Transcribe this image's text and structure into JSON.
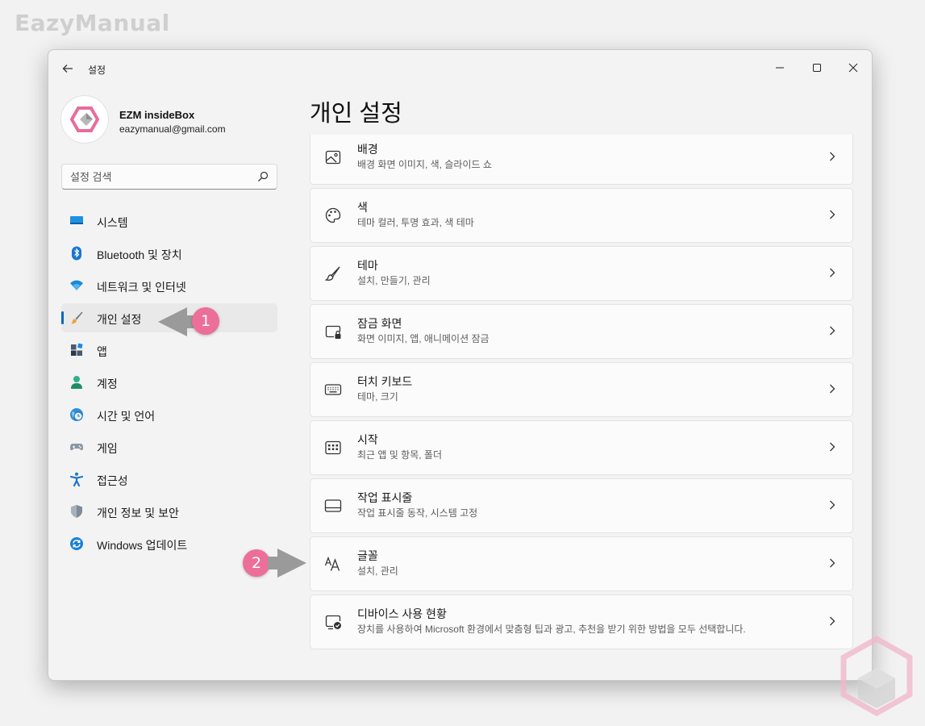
{
  "watermark": "EazyManual",
  "window": {
    "title": "설정",
    "back_icon": "arrow-left-icon",
    "controls": [
      "minimize-icon",
      "maximize-icon",
      "close-icon"
    ]
  },
  "profile": {
    "name": "EZM insideBox",
    "email": "eazymanual@gmail.com"
  },
  "search": {
    "placeholder": "설정 검색",
    "icon": "search-icon"
  },
  "sidebar": {
    "items": [
      {
        "label": "시스템",
        "icon": "system-icon",
        "active": false
      },
      {
        "label": "Bluetooth 및 장치",
        "icon": "bluetooth-icon",
        "active": false
      },
      {
        "label": "네트워크 및 인터넷",
        "icon": "wifi-icon",
        "active": false
      },
      {
        "label": "개인 설정",
        "icon": "brush-icon",
        "active": true
      },
      {
        "label": "앱",
        "icon": "apps-icon",
        "active": false
      },
      {
        "label": "계정",
        "icon": "account-icon",
        "active": false
      },
      {
        "label": "시간 및 언어",
        "icon": "time-language-icon",
        "active": false
      },
      {
        "label": "게임",
        "icon": "gamepad-icon",
        "active": false
      },
      {
        "label": "접근성",
        "icon": "accessibility-icon",
        "active": false
      },
      {
        "label": "개인 정보 및 보안",
        "icon": "shield-icon",
        "active": false
      },
      {
        "label": "Windows 업데이트",
        "icon": "update-icon",
        "active": false
      }
    ]
  },
  "main": {
    "title": "개인 설정",
    "cards": [
      {
        "title": "배경",
        "subtitle": "배경 화면 이미지, 색, 슬라이드 쇼",
        "icon": "image-icon"
      },
      {
        "title": "색",
        "subtitle": "테마 컬러, 투명 효과, 색 테마",
        "icon": "palette-icon"
      },
      {
        "title": "테마",
        "subtitle": "설치, 만들기, 관리",
        "icon": "brush-icon"
      },
      {
        "title": "잠금 화면",
        "subtitle": "화면 이미지, 앱, 애니메이션 잠금",
        "icon": "lock-screen-icon"
      },
      {
        "title": "터치 키보드",
        "subtitle": "테마, 크기",
        "icon": "keyboard-icon"
      },
      {
        "title": "시작",
        "subtitle": "최근 앱 및 항목, 폴더",
        "icon": "start-icon"
      },
      {
        "title": "작업 표시줄",
        "subtitle": "작업 표시줄 동작, 시스템 고정",
        "icon": "taskbar-icon"
      },
      {
        "title": "글꼴",
        "subtitle": "설치, 관리",
        "icon": "fonts-icon"
      },
      {
        "title": "디바이스 사용 현황",
        "subtitle": "장치를 사용하여 Microsoft 환경에서 맞춤형 팁과 광고, 추천을 받기 위한 방법을 모두 선택합니다.",
        "icon": "device-usage-icon"
      }
    ]
  },
  "annotations": [
    {
      "number": "1",
      "target": "개인 설정"
    },
    {
      "number": "2",
      "target": "글꼴"
    }
  ],
  "colors": {
    "accent": "#0067c0",
    "badge": "#ec6f9a",
    "logo_pink": "#e86d9b"
  }
}
